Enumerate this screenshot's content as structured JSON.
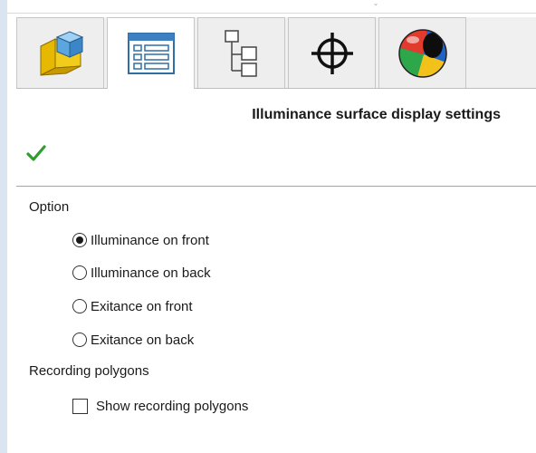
{
  "tabs": [
    {
      "icon": "part-icon",
      "active": false
    },
    {
      "icon": "property-list-icon",
      "active": true
    },
    {
      "icon": "tree-icon",
      "active": false
    },
    {
      "icon": "crosshair-icon",
      "active": false
    },
    {
      "icon": "appearance-sphere-icon",
      "active": false
    }
  ],
  "panel": {
    "title": "Illuminance surface display settings"
  },
  "colors": {
    "check": "#2e9e2e",
    "separator": "#a6a6a6",
    "strip": "#dbe5f1"
  },
  "option_section": {
    "label": "Option",
    "options": [
      {
        "label": "Illuminance on front",
        "checked": true
      },
      {
        "label": "Illuminance on back",
        "checked": false
      },
      {
        "label": "Exitance on front",
        "checked": false
      },
      {
        "label": "Exitance on back",
        "checked": false
      }
    ]
  },
  "recording_section": {
    "label": "Recording polygons",
    "checkbox_label": "Show recording polygons",
    "checked": false
  }
}
